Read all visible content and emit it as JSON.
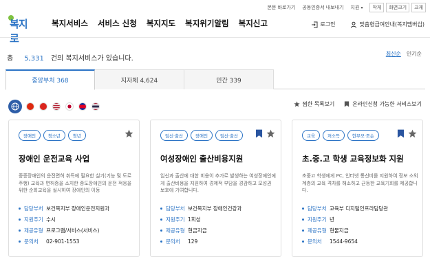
{
  "utility": {
    "links": [
      "본문 바로가기",
      "공동인증서 내보내기"
    ],
    "language_select": "지원",
    "font_buttons": [
      "작게",
      "화면크기",
      "크게"
    ]
  },
  "logo": {
    "text": "복지로"
  },
  "nav": [
    "복지서비스",
    "서비스 신청",
    "복지지도",
    "복지위기알림",
    "복지신고"
  ],
  "header_right": {
    "login": "로그인",
    "guide": "맞춤형급여안내(복지멤버십)"
  },
  "summary": {
    "prefix": "총",
    "count": "5,331",
    "suffix": "건의 복지서비스가 있습니다."
  },
  "sort": {
    "options": [
      "최신순",
      "인기순"
    ],
    "selected": "최신순"
  },
  "tabs": [
    {
      "label": "중앙부처 368",
      "active": true
    },
    {
      "label": "지자체 4,624",
      "active": false
    },
    {
      "label": "민간 339",
      "active": false
    }
  ],
  "languages": [
    "globe-icon",
    "china-flag-icon",
    "vietnam-flag-icon",
    "usa-flag-icon",
    "japan-flag-icon",
    "cambodia-flag-icon",
    "thailand-flag-icon"
  ],
  "filters": [
    "찜한 목록보기",
    "온라인신청 가능한 서비스보기"
  ],
  "colors": {
    "accent": "#2a73c5",
    "logo_green": "#7fc241",
    "globe": "#2e5ea8"
  },
  "cards": [
    {
      "tags": [
        "장애인",
        "청소년",
        "청년"
      ],
      "title": "장애인 운전교육 사업",
      "desc": "중증장애인의 운전면허 취득에 필요한 실기(기능 및 도로주행) 교육과 면허증을 소지한 중도장애인의 운전 적응을 위한 순회교육을 실시하여 장애인의 이동",
      "meta": [
        {
          "k": "담당부처",
          "v": "보건복지부 장애인운전지원과"
        },
        {
          "k": "지원주기",
          "v": "수시"
        },
        {
          "k": "제공유형",
          "v": "프로그램/서비스(서비스)"
        },
        {
          "k": "문의처",
          "v": "02-901-1553"
        }
      ]
    },
    {
      "tags": [
        "임신·출산",
        "장애인",
        "임신·출산"
      ],
      "title": "여성장애인 출산비용지원",
      "desc": "임신과 출산에 대한 비용이 추가로 발생하는 여성장애인에게 출산비용을 지원하여 경제적 부담을 경감하고 모성권 보호에 기여합니다.",
      "meta": [
        {
          "k": "담당부처",
          "v": "보건복지부 장애인건강과"
        },
        {
          "k": "지원주기",
          "v": "1회성"
        },
        {
          "k": "제공유형",
          "v": "현금지급"
        },
        {
          "k": "문의처",
          "v": "129"
        }
      ]
    },
    {
      "tags": [
        "교육",
        "저소득",
        "한부모·조손"
      ],
      "title": "초.중.고 학생 교육정보화 지원",
      "desc": "초중고 학생에게 PC, 인터넷 통신비를 지원하여 정보 소외 계층의 교육 격차를 해소하고 균등한 교육기회를 제공합니다.",
      "meta": [
        {
          "k": "담당부처",
          "v": "교육부 디지털인프라담당관"
        },
        {
          "k": "지원주기",
          "v": "년"
        },
        {
          "k": "제공유형",
          "v": "현물지급"
        },
        {
          "k": "문의처",
          "v": "1544-9654"
        }
      ]
    }
  ]
}
